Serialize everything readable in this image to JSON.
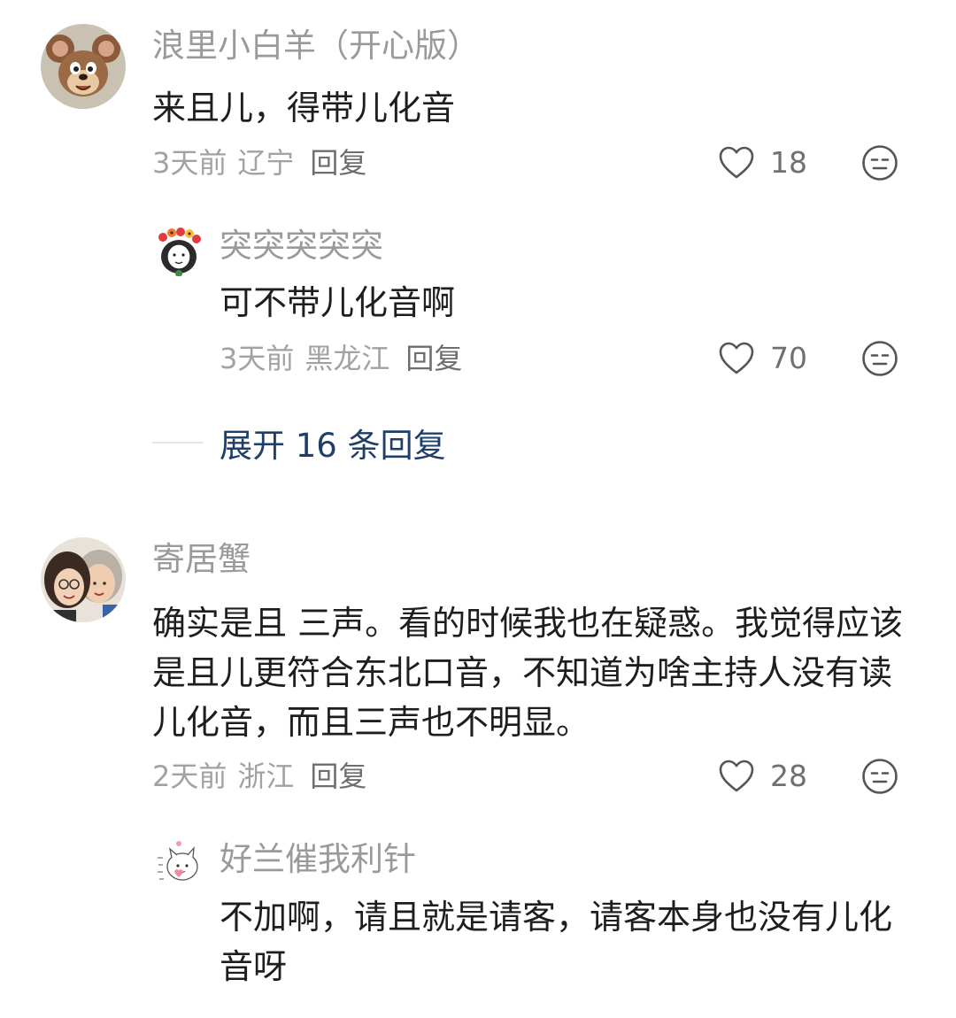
{
  "comments": [
    {
      "username": "浪里小白羊（开心版）",
      "avatar_icon": "cartoon-mouse-avatar",
      "content": "来且儿，得带儿化音",
      "time": "3天前",
      "location": "辽宁",
      "reply_label": "回复",
      "likes": "18",
      "replies": [
        {
          "username": "突突突突突",
          "avatar_icon": "flower-crown-girl-avatar",
          "content": "可不带儿化音啊",
          "time": "3天前",
          "location": "黑龙江",
          "reply_label": "回复",
          "likes": "70"
        }
      ],
      "expand_label": "展开 16 条回复"
    },
    {
      "username": "寄居蟹",
      "avatar_icon": "two-girls-selfie-avatar",
      "content": "确实是且 三声。看的时候我也在疑惑。我觉得应该是且儿更符合东北口音，不知道为啥主持人没有读儿化音，而且三声也不明显。",
      "time": "2天前",
      "location": "浙江",
      "reply_label": "回复",
      "likes": "28",
      "replies": [
        {
          "username": "好兰催我利针",
          "avatar_icon": "cute-cat-sketch-avatar",
          "content": "不加啊，请且就是请客，请客本身也没有儿化音呀"
        }
      ]
    }
  ],
  "colors": {
    "username": "#9a9a9a",
    "content": "#1e1e1e",
    "meta": "#a2a2a2",
    "link": "#1f3f6a",
    "icon": "#555555"
  }
}
